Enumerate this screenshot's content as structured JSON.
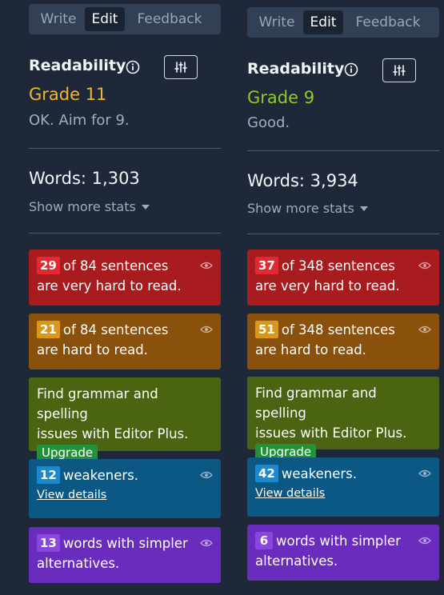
{
  "colors": {
    "background": "#1e2838",
    "grade_orange": "#f2b438",
    "grade_green": "#92c92a",
    "very_hard": "#a81b1f",
    "hard": "#8a510c",
    "promo": "#4a6411",
    "weakeners": "#0c5884",
    "simpler": "#6a2cbd"
  },
  "panels": [
    {
      "tabs": [
        "Write",
        "Edit",
        "Feedback"
      ],
      "active_tab": "Edit",
      "readability_label": "Readability",
      "grade": "Grade 11",
      "grade_color": "#f2b438",
      "grade_description": "OK. Aim for 9.",
      "words": "Words: 1,303",
      "show_more": "Show more stats",
      "very_hard": {
        "count": "29",
        "text_1": "of 84 sentences",
        "text_2": "are very hard to read."
      },
      "hard": {
        "count": "21",
        "text_1": "of 84 sentences",
        "text_2": "are hard to read."
      },
      "promo": {
        "text_1": "Find grammar and spelling",
        "text_2": "issues with Editor Plus.",
        "button": "Upgrade"
      },
      "weakeners": {
        "count": "12",
        "text": "weakeners.",
        "link": "View details"
      },
      "simpler": {
        "count": "13",
        "text_1": "words with simpler",
        "text_2": "alternatives."
      }
    },
    {
      "tabs": [
        "Write",
        "Edit",
        "Feedback"
      ],
      "active_tab": "Edit",
      "readability_label": "Readability",
      "grade": "Grade 9",
      "grade_color": "#92c92a",
      "grade_description": "Good.",
      "words": "Words: 3,934",
      "show_more": "Show more stats",
      "very_hard": {
        "count": "37",
        "text_1": "of 348 sentences",
        "text_2": "are very hard to read."
      },
      "hard": {
        "count": "51",
        "text_1": "of 348 sentences",
        "text_2": "are hard to read."
      },
      "promo": {
        "text_1": "Find grammar and spelling",
        "text_2": "issues with Editor Plus.",
        "button": "Upgrade"
      },
      "weakeners": {
        "count": "42",
        "text": "weakeners.",
        "link": "View details"
      },
      "simpler": {
        "count": "6",
        "text_1": "words with simpler",
        "text_2": "alternatives."
      }
    }
  ],
  "icons": {
    "info": "info-icon",
    "settings": "sliders-icon",
    "show_more": "caret-down-icon",
    "visibility": "eye-icon"
  }
}
